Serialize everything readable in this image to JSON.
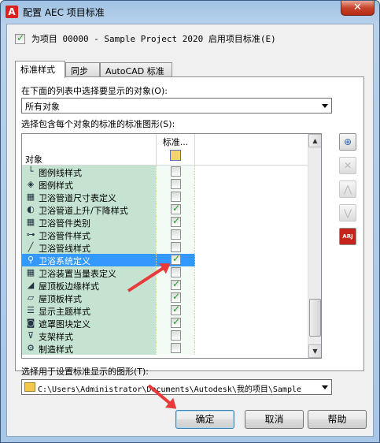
{
  "window": {
    "title": "配置 AEC 项目标准",
    "app_icon": "A",
    "close_label": "✕"
  },
  "project": {
    "enabled": true,
    "label": "为项目 00000 - Sample Project 2020 启用项目标准(E)"
  },
  "tabs": [
    {
      "label": "标准样式",
      "active": true
    },
    {
      "label": "同步",
      "active": false
    },
    {
      "label": "AutoCAD 标准",
      "active": false
    }
  ],
  "filter": {
    "label": "在下面的列表中选择要显示的对象(O):",
    "value": "所有对象"
  },
  "drawings": {
    "label": "选择包含每个对象的标准的标准图形(S):"
  },
  "list": {
    "header_object": "对象",
    "header_standard": "标准..."
  },
  "rows": [
    {
      "icon": "legend-line-style-icon",
      "glyph": "└",
      "name": "图例线样式",
      "checked": false,
      "selected": false
    },
    {
      "icon": "legend-style-icon",
      "glyph": "◈",
      "name": "图例样式",
      "checked": false,
      "selected": false
    },
    {
      "icon": "table-icon",
      "glyph": "▦",
      "name": "卫浴管道尺寸表定义",
      "checked": false,
      "selected": false
    },
    {
      "icon": "pipe-rise-drop-icon",
      "glyph": "◐",
      "name": "卫浴管道上升/下降样式",
      "checked": true,
      "selected": false
    },
    {
      "icon": "table-icon",
      "glyph": "▦",
      "name": "卫浴管件类别",
      "checked": true,
      "selected": false
    },
    {
      "icon": "fitting-icon",
      "glyph": "⊶",
      "name": "卫浴管件样式",
      "checked": false,
      "selected": false
    },
    {
      "icon": "line-icon",
      "glyph": "╱",
      "name": "卫浴管线样式",
      "checked": false,
      "selected": false
    },
    {
      "icon": "system-icon",
      "glyph": "⚲",
      "name": "卫浴系统定义",
      "checked": true,
      "selected": true
    },
    {
      "icon": "table-icon",
      "glyph": "▦",
      "name": "卫浴装置当量表定义",
      "checked": false,
      "selected": false
    },
    {
      "icon": "roof-edge-icon",
      "glyph": "◢",
      "name": "屋顶板边缘样式",
      "checked": true,
      "selected": false
    },
    {
      "icon": "roof-slab-icon",
      "glyph": "▱",
      "name": "屋顶板样式",
      "checked": true,
      "selected": false
    },
    {
      "icon": "display-theme-icon",
      "glyph": "☰",
      "name": "显示主题样式",
      "checked": true,
      "selected": false
    },
    {
      "icon": "mask-block-icon",
      "glyph": "◙",
      "name": "遮罩图块定义",
      "checked": true,
      "selected": false
    },
    {
      "icon": "support-icon",
      "glyph": "⊽",
      "name": "支架样式",
      "checked": false,
      "selected": false
    },
    {
      "icon": "manufacture-icon",
      "glyph": "⚙",
      "name": "制造样式",
      "checked": false,
      "selected": false
    }
  ],
  "side_buttons": [
    {
      "icon": "add-drawing-icon",
      "glyph": "⊕",
      "enabled": true
    },
    {
      "icon": "remove-drawing-icon",
      "glyph": "✕",
      "enabled": false
    },
    {
      "icon": "move-up-icon",
      "glyph": "⋀",
      "enabled": false
    },
    {
      "icon": "move-down-icon",
      "glyph": "⋁",
      "enabled": false
    },
    {
      "icon": "arj-icon",
      "glyph": "ARJ",
      "enabled": true
    }
  ],
  "display": {
    "label": "选择用于设置标准显示的图形(T):",
    "path": "C:\\Users\\Administrator\\Documents\\Autodesk\\我的项目\\Sample"
  },
  "buttons": {
    "ok": "确定",
    "cancel": "取消",
    "help": "帮助"
  },
  "colors": {
    "row_bg": "#c5e3d1",
    "selected": "#3399ff",
    "arrow": "#e83a3a"
  }
}
